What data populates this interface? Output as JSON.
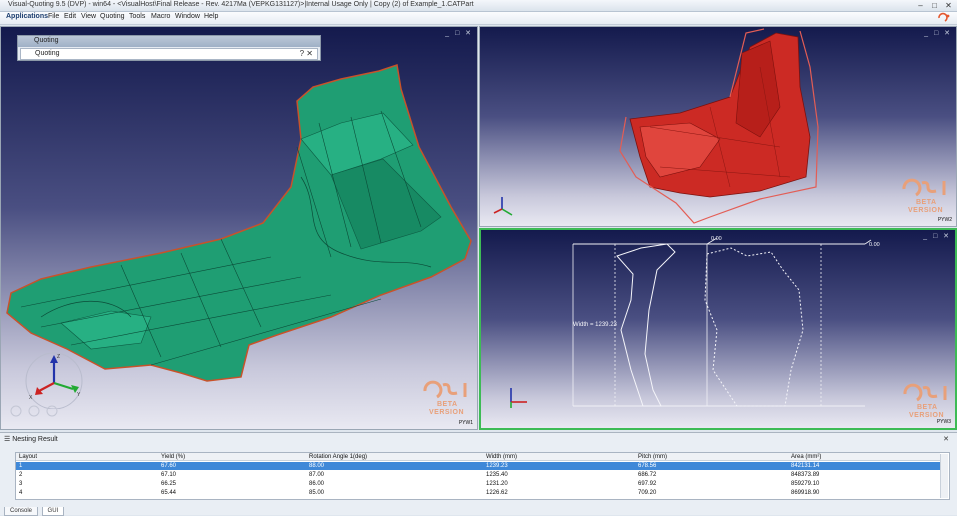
{
  "window": {
    "title": "Visual-Quoting 9.5 (DVP) - win64 - <VisualHost\\Final Release - Rev. 4217Ma (VEPKG131127)>|Internal Usage Only | Copy (2) of Example_1.CATPart",
    "minimize": "–",
    "maximize": "□",
    "close": "✕"
  },
  "menu": {
    "applications": "Applications",
    "items": [
      "File",
      "Edit",
      "View",
      "Quoting",
      "Tools",
      "Macro",
      "Window",
      "Help"
    ]
  },
  "quoting_panel": {
    "title": "Quoting",
    "row_label": "Quoting",
    "help_icon": "?",
    "close_icon": "✕"
  },
  "viewport_controls": "_ □ ✕",
  "watermark": {
    "beta": "BETA",
    "version": "VERSION"
  },
  "viewports": {
    "left_tag": "PYW1",
    "right_top_tag": "PYW2",
    "right_bottom_tag": "PYW3"
  },
  "nesting": {
    "width_label": "Width = 1239.23",
    "dim_top_left": "0.00",
    "dim_top_right": "0.00"
  },
  "axes": {
    "x": "X",
    "y": "Y",
    "z": "Z"
  },
  "bottom_panel": {
    "title": "Nesting Result",
    "close": "✕",
    "columns": [
      "Layout",
      "Yield (%)",
      "Rotation Angle 1(deg)",
      "Width (mm)",
      "Pitch (mm)",
      "Area (mm²)"
    ],
    "rows": [
      [
        "1",
        "67.60",
        "88.00",
        "1239.23",
        "678.56",
        "842131.14"
      ],
      [
        "2",
        "67.10",
        "87.00",
        "1235.40",
        "686.72",
        "848373.89"
      ],
      [
        "3",
        "66.25",
        "86.00",
        "1231.20",
        "697.92",
        "859279.10"
      ],
      [
        "4",
        "65.44",
        "85.00",
        "1226.62",
        "709.20",
        "869918.90"
      ]
    ],
    "selected_row": 0,
    "tabs": [
      "Console",
      "GUI"
    ]
  },
  "colors": {
    "part_green": "#1f9e73",
    "part_red": "#cc2a24",
    "selection": "#3f88d8",
    "active_border": "#3dbb55",
    "esi_orange": "#e8a07a"
  }
}
